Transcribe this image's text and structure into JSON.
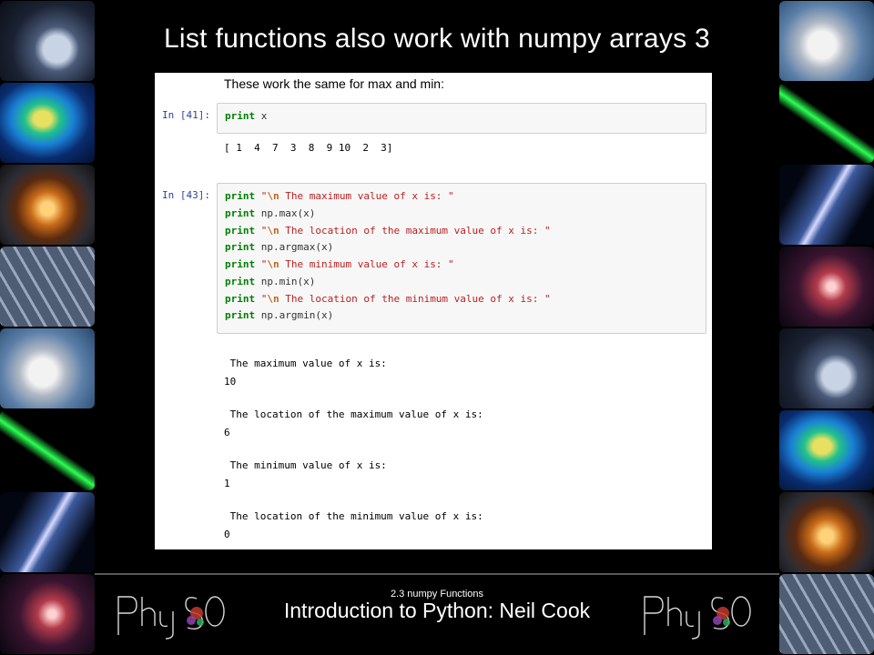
{
  "slide": {
    "title": "List functions also work with numpy arrays 3",
    "section": "2.3 numpy Functions",
    "course_title": "Introduction to Python: Neil Cook"
  },
  "notebook": {
    "description": "These work the same for max and min:",
    "cells": [
      {
        "prompt": "In [41]:",
        "code": [
          {
            "kw": "print",
            "rest": " x"
          }
        ],
        "output": "[ 1  4  7  3  8  9 10  2  3]"
      },
      {
        "prompt": "In [43]:",
        "code": [
          {
            "kw": "print",
            "pre": " ",
            "str_open": "\"",
            "esc": "\\n",
            "str_body": " The maximum value of x is: \""
          },
          {
            "kw": "print",
            "rest": " np.max(x)"
          },
          {
            "kw": "print",
            "pre": " ",
            "str_open": "\"",
            "esc": "\\n",
            "str_body": " The location of the maximum value of x is: \""
          },
          {
            "kw": "print",
            "rest": " np.argmax(x)"
          },
          {
            "kw": "print",
            "pre": " ",
            "str_open": "\"",
            "esc": "\\n",
            "str_body": " The minimum value of x is: \""
          },
          {
            "kw": "print",
            "rest": " np.min(x)"
          },
          {
            "kw": "print",
            "pre": " ",
            "str_open": "\"",
            "esc": "\\n",
            "str_body": " The location of the minimum value of x is: \""
          },
          {
            "kw": "print",
            "rest": " np.argmin(x)"
          }
        ],
        "output_lines": [
          " The maximum value of x is:",
          "10",
          " The location of the maximum value of x is:",
          "6",
          " The minimum value of x is:",
          "1",
          " The location of the minimum value of x is:",
          "0"
        ]
      }
    ]
  },
  "logo_text": "PhysSoc",
  "colors": {
    "background": "#000000",
    "keyword": "#008000",
    "string": "#ba2121",
    "prompt": "#303f9f"
  }
}
